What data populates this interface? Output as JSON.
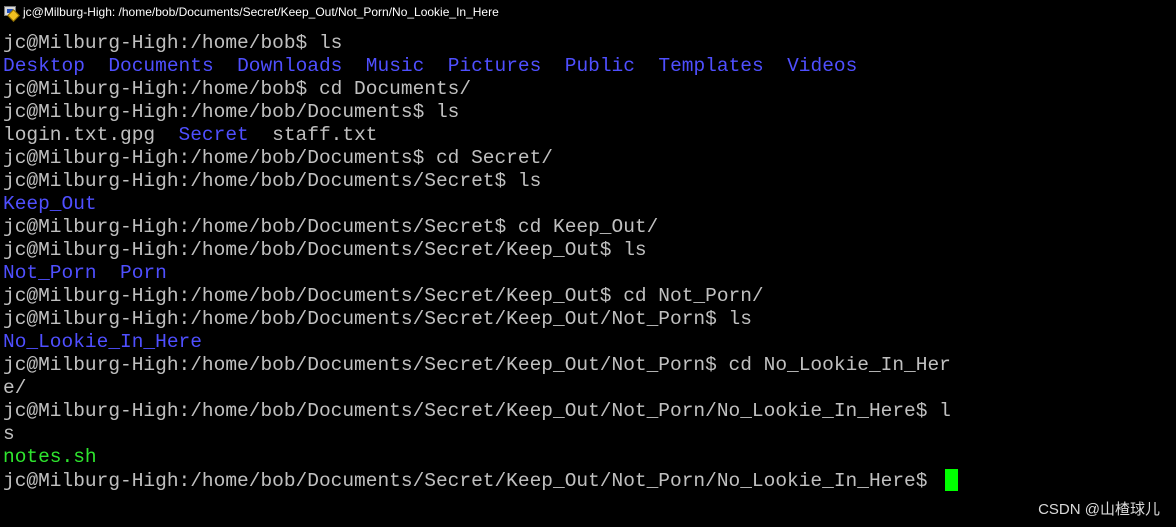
{
  "window": {
    "title": "jc@Milburg-High: /home/bob/Documents/Secret/Keep_Out/Not_Porn/No_Lookie_In_Here",
    "icon": "terminal-app-icon"
  },
  "colors": {
    "background": "#000000",
    "text": "#c0c0c0",
    "directory": "#4f4fff",
    "executable": "#2ee62e",
    "cursor": "#00ff00"
  },
  "terminal": {
    "lines": [
      {
        "type": "cmd",
        "text": "jc@Milburg-High:/home/bob$ ls"
      },
      {
        "type": "ls",
        "entries": [
          {
            "text": "Desktop",
            "kind": "dir"
          },
          {
            "text": "Documents",
            "kind": "dir"
          },
          {
            "text": "Downloads",
            "kind": "dir"
          },
          {
            "text": "Music",
            "kind": "dir"
          },
          {
            "text": "Pictures",
            "kind": "dir"
          },
          {
            "text": "Public",
            "kind": "dir"
          },
          {
            "text": "Templates",
            "kind": "dir"
          },
          {
            "text": "Videos",
            "kind": "dir"
          }
        ]
      },
      {
        "type": "cmd",
        "text": "jc@Milburg-High:/home/bob$ cd Documents/"
      },
      {
        "type": "cmd",
        "text": "jc@Milburg-High:/home/bob/Documents$ ls"
      },
      {
        "type": "ls",
        "entries": [
          {
            "text": "login.txt.gpg",
            "kind": "file"
          },
          {
            "text": "Secret",
            "kind": "dir"
          },
          {
            "text": "staff.txt",
            "kind": "file"
          }
        ]
      },
      {
        "type": "cmd",
        "text": "jc@Milburg-High:/home/bob/Documents$ cd Secret/"
      },
      {
        "type": "cmd",
        "text": "jc@Milburg-High:/home/bob/Documents/Secret$ ls"
      },
      {
        "type": "ls",
        "entries": [
          {
            "text": "Keep_Out",
            "kind": "dir"
          }
        ]
      },
      {
        "type": "cmd",
        "text": "jc@Milburg-High:/home/bob/Documents/Secret$ cd Keep_Out/"
      },
      {
        "type": "cmd",
        "text": "jc@Milburg-High:/home/bob/Documents/Secret/Keep_Out$ ls"
      },
      {
        "type": "ls",
        "entries": [
          {
            "text": "Not_Porn",
            "kind": "dir"
          },
          {
            "text": "Porn",
            "kind": "dir"
          }
        ]
      },
      {
        "type": "cmd",
        "text": "jc@Milburg-High:/home/bob/Documents/Secret/Keep_Out$ cd Not_Porn/"
      },
      {
        "type": "cmd",
        "text": "jc@Milburg-High:/home/bob/Documents/Secret/Keep_Out/Not_Porn$ ls"
      },
      {
        "type": "ls",
        "entries": [
          {
            "text": "No_Lookie_In_Here",
            "kind": "dir"
          }
        ]
      },
      {
        "type": "cmd",
        "text": "jc@Milburg-High:/home/bob/Documents/Secret/Keep_Out/Not_Porn$ cd No_Lookie_In_Her"
      },
      {
        "type": "cmd",
        "text": "e/"
      },
      {
        "type": "cmd",
        "text": "jc@Milburg-High:/home/bob/Documents/Secret/Keep_Out/Not_Porn/No_Lookie_In_Here$ l"
      },
      {
        "type": "cmd",
        "text": "s"
      },
      {
        "type": "ls",
        "entries": [
          {
            "text": "notes.sh",
            "kind": "exec"
          }
        ]
      },
      {
        "type": "prompt",
        "text": "jc@Milburg-High:/home/bob/Documents/Secret/Keep_Out/Not_Porn/No_Lookie_In_Here$ "
      }
    ]
  },
  "watermark": "CSDN @山楂球儿"
}
